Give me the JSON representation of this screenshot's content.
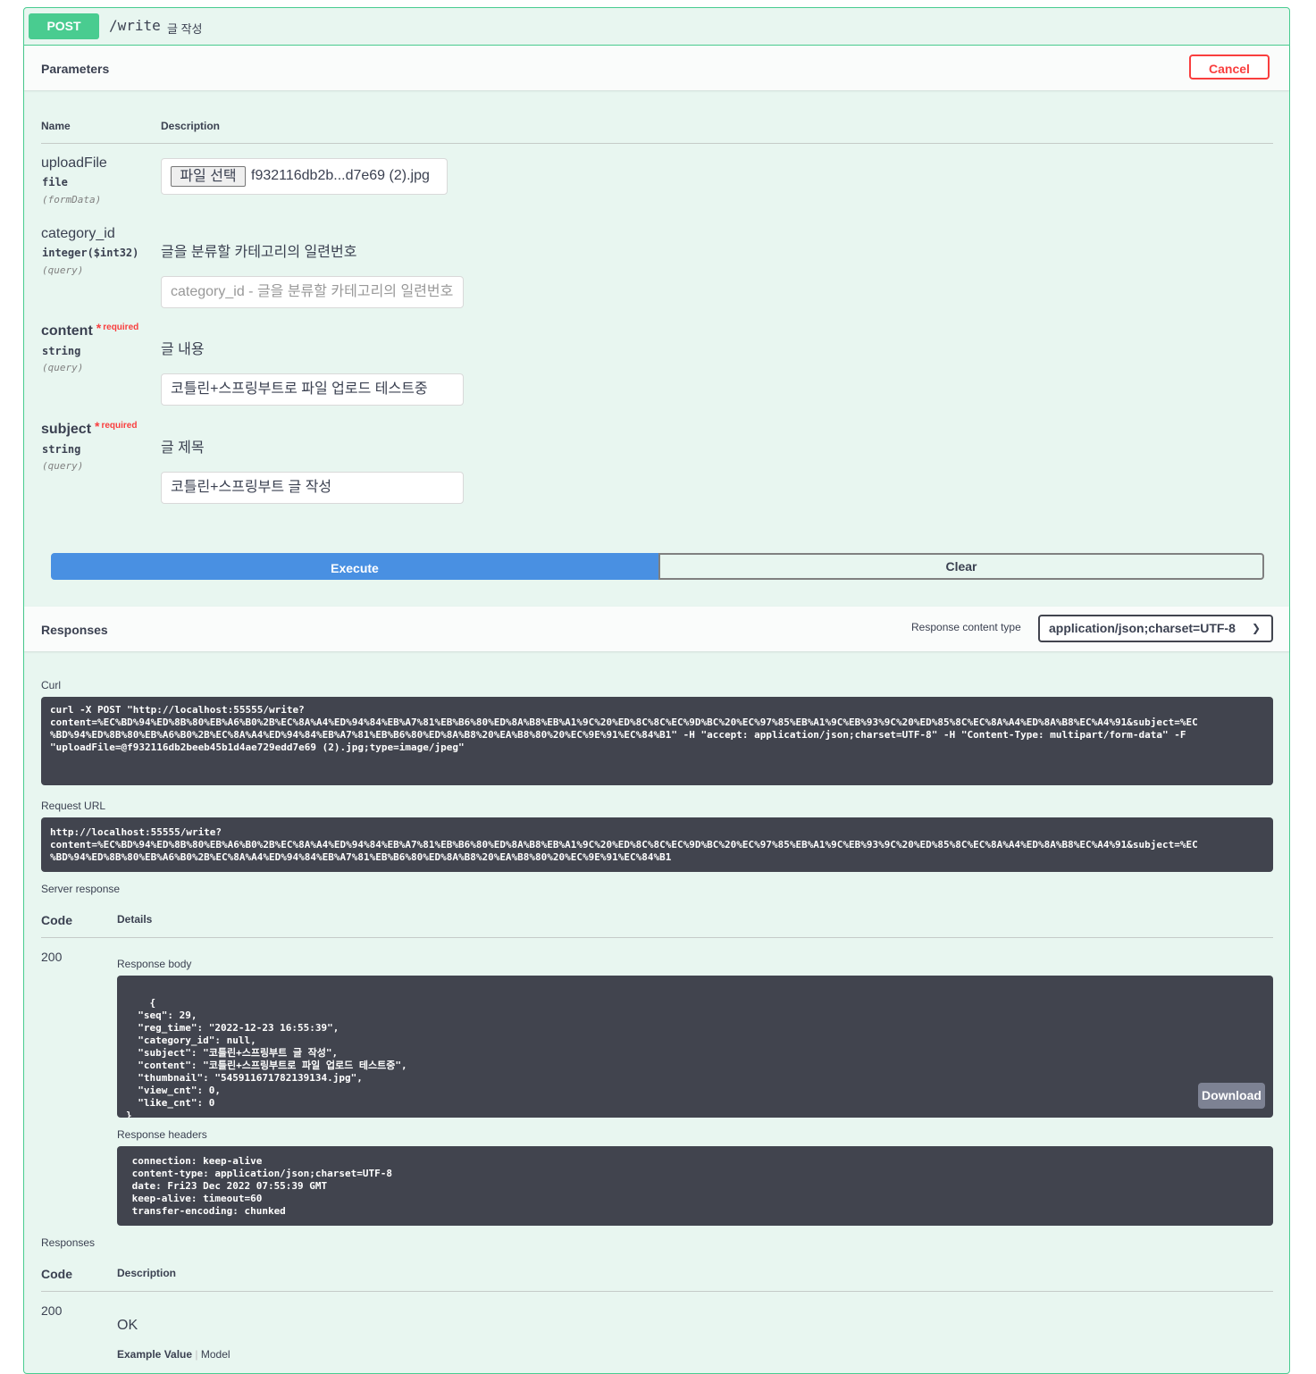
{
  "summary": {
    "method": "POST",
    "path": "/write",
    "description": "글 작성"
  },
  "parameters": {
    "title": "Parameters",
    "cancel_label": "Cancel",
    "col_name": "Name",
    "col_description": "Description",
    "items": [
      {
        "name": "uploadFile",
        "type": "file",
        "in": "(formData)",
        "file_button": "파일 선택",
        "file_name": "f932116db2b...d7e69 (2).jpg"
      },
      {
        "name": "category_id",
        "type": "integer($int32)",
        "in": "(query)",
        "description": "글을 분류할 카테고리의 일련번호",
        "placeholder": "category_id - 글을 분류할 카테고리의 일련번호"
      },
      {
        "name": "content",
        "required_mark": "*",
        "required_text": "required",
        "type": "string",
        "in": "(query)",
        "description": "글 내용",
        "value": "코틀린+스프링부트로 파일 업로드 테스트중"
      },
      {
        "name": "subject",
        "required_mark": "*",
        "required_text": "required",
        "type": "string",
        "in": "(query)",
        "description": "글 제목",
        "value": "코틀린+스프링부트 글 작성"
      }
    ],
    "execute_label": "Execute",
    "clear_label": "Clear"
  },
  "responses_header": {
    "title": "Responses",
    "content_type_label": "Response content type",
    "content_type_value": "application/json;charset=UTF-8"
  },
  "curl": {
    "label": "Curl",
    "text": "curl -X POST \"http://localhost:55555/write?\ncontent=%EC%BD%94%ED%8B%80%EB%A6%B0%2B%EC%8A%A4%ED%94%84%EB%A7%81%EB%B6%80%ED%8A%B8%EB%A1%9C%20%ED%8C%8C%EC%9D%BC%20%EC%97%85%EB%A1%9C%EB%93%9C%20%ED%85%8C%EC%8A%A4%ED%8A%B8%EC%A4%91&subject=%EC\n%BD%94%ED%8B%80%EB%A6%B0%2B%EC%8A%A4%ED%94%84%EB%A7%81%EB%B6%80%ED%8A%B8%20%EA%B8%80%20%EC%9E%91%EC%84%B1\" -H \"accept: application/json;charset=UTF-8\" -H \"Content-Type: multipart/form-data\" -F\n\"uploadFile=@f932116db2beeb45b1d4ae729edd7e69 (2).jpg;type=image/jpeg\""
  },
  "request_url": {
    "label": "Request URL",
    "text": "http://localhost:55555/write?\ncontent=%EC%BD%94%ED%8B%80%EB%A6%B0%2B%EC%8A%A4%ED%94%84%EB%A7%81%EB%B6%80%ED%8A%B8%EB%A1%9C%20%ED%8C%8C%EC%9D%BC%20%EC%97%85%EB%A1%9C%EB%93%9C%20%ED%85%8C%EC%8A%A4%ED%8A%B8%EC%A4%91&subject=%EC\n%BD%94%ED%8B%80%EB%A6%B0%2B%EC%8A%A4%ED%94%84%EB%A7%81%EB%B6%80%ED%8A%B8%20%EA%B8%80%20%EC%9E%91%EC%84%B1"
  },
  "server_response": {
    "label": "Server response",
    "col_code": "Code",
    "col_details": "Details",
    "code": "200",
    "body_label": "Response body",
    "body": "{\n  \"seq\": 29,\n  \"reg_time\": \"2022-12-23 16:55:39\",\n  \"category_id\": null,\n  \"subject\": \"코틀린+스프링부트 글 작성\",\n  \"content\": \"코틀린+스프링부트로 파일 업로드 테스트중\",\n  \"thumbnail\": \"545911671782139134.jpg\",\n  \"view_cnt\": 0,\n  \"like_cnt\": 0\n}",
    "download_label": "Download",
    "headers_label": "Response headers",
    "headers": " connection: keep-alive \n content-type: application/json;charset=UTF-8 \n date: Fri23 Dec 2022 07:55:39 GMT \n keep-alive: timeout=60 \n transfer-encoding: chunked "
  },
  "responses": {
    "label": "Responses",
    "col_code": "Code",
    "col_description": "Description",
    "code": "200",
    "description": "OK",
    "example_value": "Example Value",
    "model": "Model"
  }
}
